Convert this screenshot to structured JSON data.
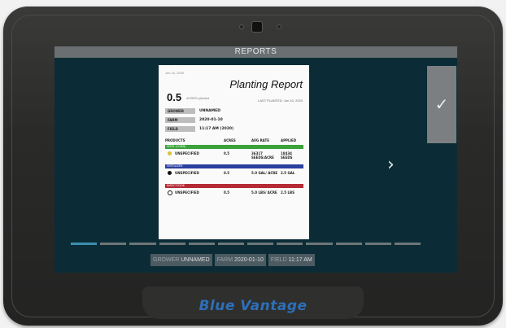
{
  "window": {
    "title": "REPORTS"
  },
  "report": {
    "date": "Jun 10, 2020",
    "title": "Planting Report",
    "acres_value": "0.5",
    "acres_label": "ACRES planted",
    "last_planted": "LAST PLANTED: Jun 10, 2020",
    "fields": [
      {
        "label": "GROWER",
        "value": "UNNAMED"
      },
      {
        "label": "FARM",
        "value": "2020-01-10"
      },
      {
        "label": "FIELD",
        "value": "11:17 AM (2020)"
      }
    ],
    "table_headers": [
      "PRODUCTS",
      "ACRES",
      "AVG RATE",
      "APPLIED"
    ],
    "sections": [
      {
        "category": "SEED (CORN)",
        "color": "#3aa23a",
        "icon": "seed-icon",
        "product": "UNSPECIFIED",
        "acres": "0.5",
        "avg_rate": "36317 SEEDS/ACRE",
        "applied": "18434 SEEDS"
      },
      {
        "category": "FERTILIZER",
        "color": "#2b3fa0",
        "icon": "droplet-icon",
        "product": "UNSPECIFIED",
        "acres": "0.5",
        "avg_rate": "5.0 GAL/ ACRE",
        "applied": "2.5 GAL"
      },
      {
        "category": "INSECTICIDE",
        "color": "#b52a35",
        "icon": "bug-icon",
        "product": "UNSPECIFIED",
        "acres": "0.5",
        "avg_rate": "5.0 LBS/ ACRE",
        "applied": "2.5 LBS"
      }
    ]
  },
  "controls": {
    "confirm_icon": "checkmark-icon",
    "next_icon": "chevron-right-icon",
    "confirm_glyph": "✓",
    "next_glyph": "›"
  },
  "progress": {
    "total_segments": 12,
    "current_segment": 1
  },
  "status_chips": [
    {
      "key": "GROWER",
      "value": "UNNAMED"
    },
    {
      "key": "FARM",
      "value": "2020-01-10"
    },
    {
      "key": "FIELD",
      "value": "11:17 AM"
    }
  ],
  "brand": {
    "name": "Blue Vantage",
    "color": "#2d6fb8"
  }
}
